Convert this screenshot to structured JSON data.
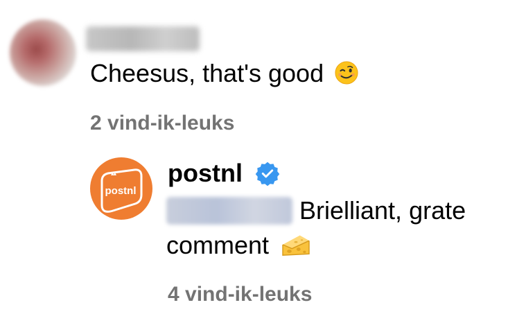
{
  "comment": {
    "text": "Cheesus, that's good",
    "emoji": "winking-face",
    "likes_label": "2 vind-ik-leuks"
  },
  "reply": {
    "username": "postnl",
    "verified": true,
    "avatar_logo_text": "postnl",
    "text_line1": "Brielliant, grate",
    "text_line2": "comment",
    "emoji": "cheese-wedge",
    "likes_label": "4 vind-ik-leuks"
  },
  "colors": {
    "postnl_orange": "#ef7d31",
    "verified_blue": "#3897f0",
    "secondary_text": "#737373"
  }
}
